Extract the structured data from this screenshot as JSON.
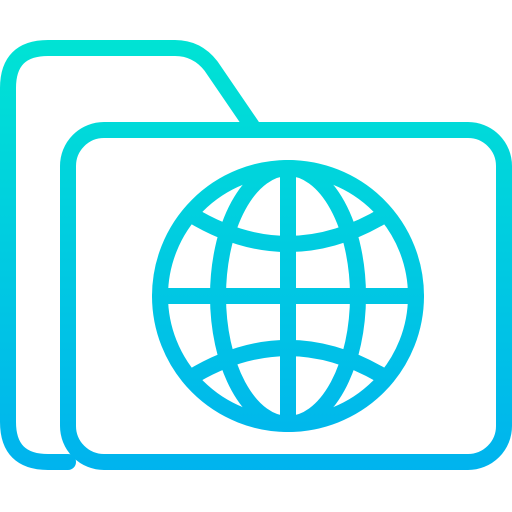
{
  "icon": {
    "name": "globe-folder-icon",
    "parts": [
      "folder-icon",
      "globe-icon"
    ],
    "style": "outline",
    "gradient": {
      "direction": "top-to-bottom",
      "top_color": "#00E3D4",
      "bottom_color": "#00B3EE"
    }
  }
}
